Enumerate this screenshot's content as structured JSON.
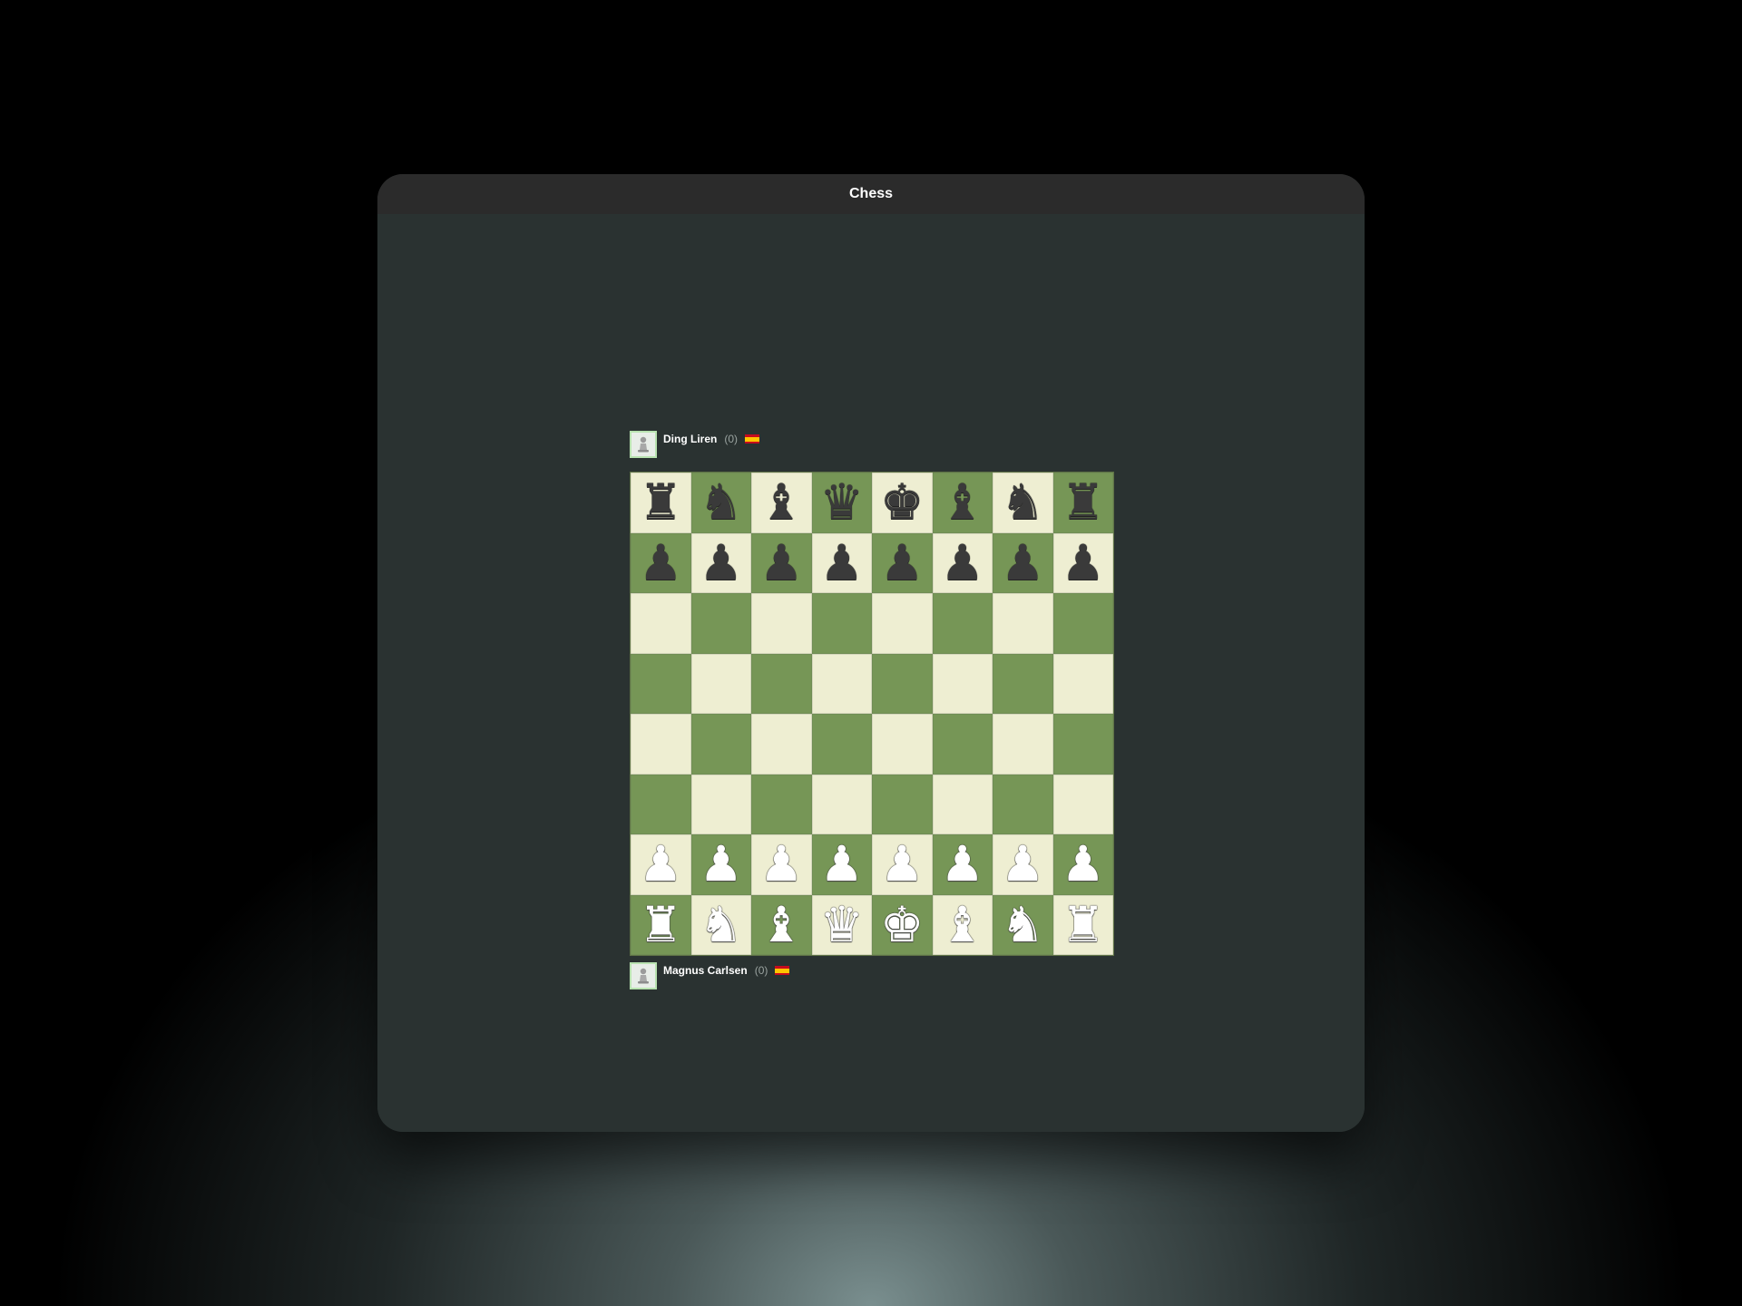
{
  "window": {
    "title": "Chess"
  },
  "players": {
    "top": {
      "name": "Ding Liren",
      "rating": "(0)",
      "flag": "spain-flag-icon"
    },
    "bottom": {
      "name": "Magnus Carlsen",
      "rating": "(0)",
      "flag": "spain-flag-icon"
    }
  },
  "board": {
    "light_color": "#eeeed2",
    "dark_color": "#769656",
    "files": [
      "a",
      "b",
      "c",
      "d",
      "e",
      "f",
      "g",
      "h"
    ],
    "ranks": [
      [
        "bR",
        "bN",
        "bB",
        "bQ",
        "bK",
        "bB",
        "bN",
        "bR"
      ],
      [
        "bP",
        "bP",
        "bP",
        "bP",
        "bP",
        "bP",
        "bP",
        "bP"
      ],
      [
        "",
        "",
        "",
        "",
        "",
        "",
        "",
        ""
      ],
      [
        "",
        "",
        "",
        "",
        "",
        "",
        "",
        ""
      ],
      [
        "",
        "",
        "",
        "",
        "",
        "",
        "",
        ""
      ],
      [
        "",
        "",
        "",
        "",
        "",
        "",
        "",
        ""
      ],
      [
        "wP",
        "wP",
        "wP",
        "wP",
        "wP",
        "wP",
        "wP",
        "wP"
      ],
      [
        "wR",
        "wN",
        "wB",
        "wQ",
        "wK",
        "wB",
        "wN",
        "wR"
      ]
    ]
  }
}
